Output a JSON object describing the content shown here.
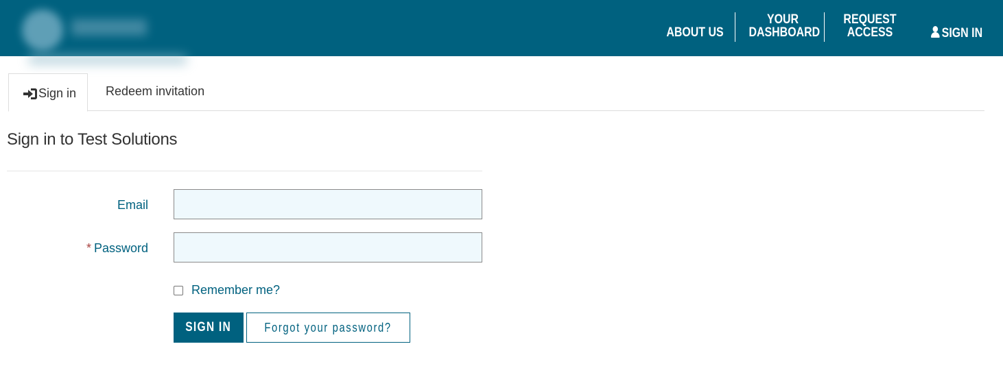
{
  "header": {
    "nav": {
      "about": "ABOUT US",
      "dashboard_line1": "YOUR",
      "dashboard_line2": "DASHBOARD",
      "request_line1": "REQUEST",
      "request_line2": "ACCESS",
      "signin": "SIGN IN"
    },
    "colors": {
      "bar": "#00617f",
      "text": "#ffffff"
    },
    "icons": {
      "signin": "person-icon"
    }
  },
  "tabs": [
    {
      "label": "Sign in",
      "icon": "sign-in-icon",
      "active": true
    },
    {
      "label": "Redeem invitation",
      "active": false
    }
  ],
  "main": {
    "title": "Sign in to Test Solutions",
    "form": {
      "email_label": "Email",
      "email_value": "",
      "password_required_marker": "*",
      "password_label": "Password",
      "password_value": "",
      "remember_label": "Remember me?",
      "remember_checked": false,
      "submit_label": "SIGN IN",
      "forgot_label": "Forgot your password?"
    }
  }
}
